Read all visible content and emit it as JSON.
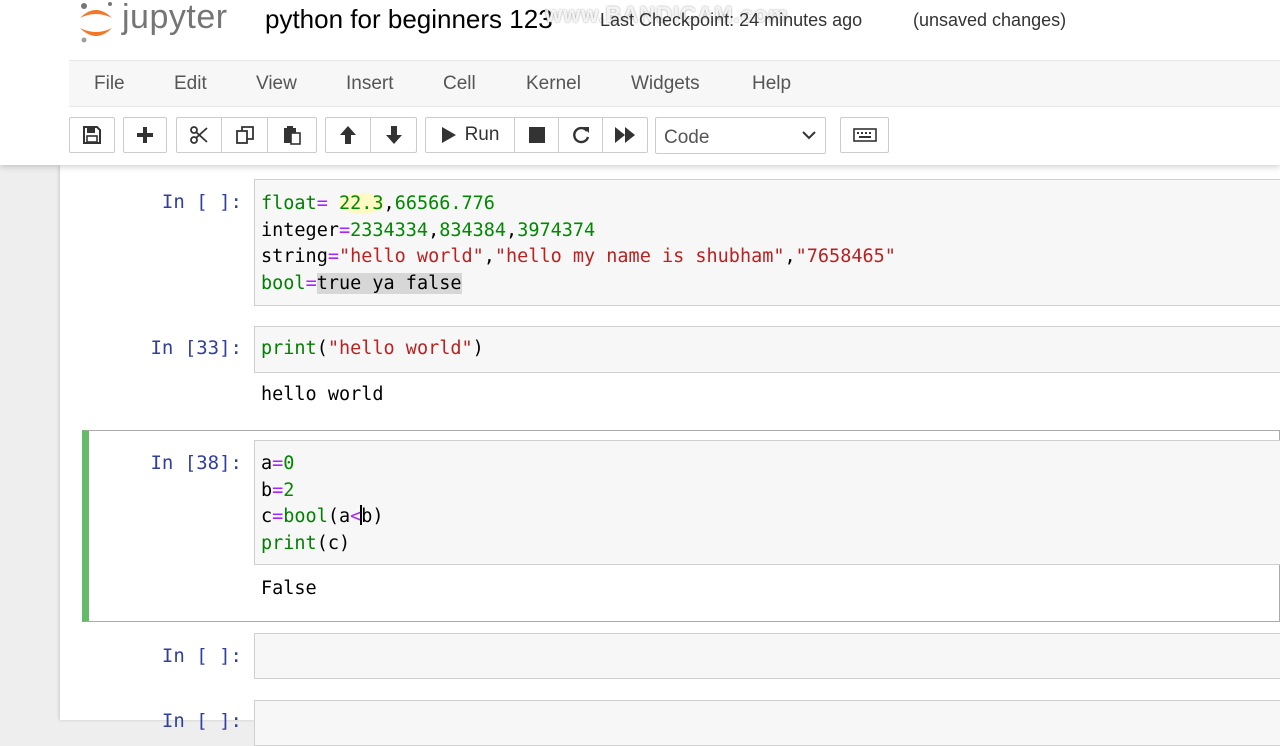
{
  "header": {
    "logo_text": "jupyter",
    "notebook_title": "python for beginners 123",
    "checkpoint": "Last Checkpoint: 24 minutes ago",
    "unsaved": "(unsaved changes)",
    "watermark": "www.BANDICAM.com"
  },
  "menu": [
    "File",
    "Edit",
    "View",
    "Insert",
    "Cell",
    "Kernel",
    "Widgets",
    "Help"
  ],
  "toolbar": {
    "run_label": "Run",
    "cell_type": "Code",
    "buttons": [
      "save-icon",
      "plus-icon",
      "scissors-icon",
      "copy-icon",
      "paste-icon",
      "arrow-up-icon",
      "arrow-down-icon",
      "play-icon",
      "stop-icon",
      "restart-icon",
      "fast-forward-icon",
      "keyboard-icon"
    ]
  },
  "cells": [
    {
      "prompt": "In [ ]:",
      "lines": [
        [
          "float",
          "= ",
          "22.3",
          ",",
          "66566.776"
        ],
        [
          "integer",
          "=",
          "2334334",
          ",",
          "834384",
          ",",
          "3974374"
        ],
        [
          "string",
          "=",
          "\"hello world\"",
          ",",
          "\"hello my name is shubham\"",
          ",",
          "\"7658465\""
        ],
        [
          "bool",
          "=",
          "true ya false"
        ]
      ]
    },
    {
      "prompt": "In [33]:",
      "lines": [
        [
          "print",
          "(",
          "\"hello world\"",
          ")"
        ]
      ],
      "output": "hello world"
    },
    {
      "prompt": "In [38]:",
      "lines": [
        [
          "a",
          "=",
          "0"
        ],
        [
          "b",
          "=",
          "2"
        ],
        [
          "c",
          "=",
          "bool",
          "(a",
          "<",
          "b)"
        ],
        [
          "print",
          "(c)"
        ]
      ],
      "output": "False"
    },
    {
      "prompt": "In [ ]:"
    },
    {
      "prompt": "In [ ]:"
    }
  ],
  "colors": {
    "prompt": "#303f9f",
    "selected_border": "#66bb6a",
    "string": "#ba2121",
    "number": "#008800",
    "builtin": "#008000"
  }
}
